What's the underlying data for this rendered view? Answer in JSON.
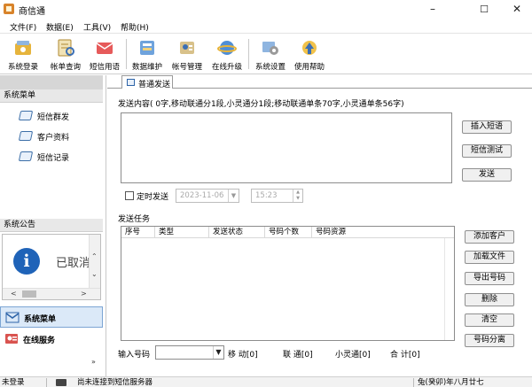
{
  "window": {
    "title": "商信通"
  },
  "menu": [
    "文件(F)",
    "数据(E)",
    "工具(V)",
    "帮助(H)"
  ],
  "toolbar": [
    {
      "label": "系统登录",
      "icon": "login-icon"
    },
    {
      "label": "帐单查询",
      "icon": "bill-query-icon"
    },
    {
      "label": "短信用语",
      "icon": "phrases-icon"
    },
    {
      "label": "数据维护",
      "icon": "data-maintenance-icon"
    },
    {
      "label": "帐号管理",
      "icon": "account-icon"
    },
    {
      "label": "在线升级",
      "icon": "upgrade-icon"
    },
    {
      "label": "系统设置",
      "icon": "settings-icon"
    },
    {
      "label": "使用帮助",
      "icon": "help-icon"
    }
  ],
  "sidebar": {
    "menu_header": "系统菜单",
    "items": [
      "短信群发",
      "客户资料",
      "短信记录"
    ],
    "notice_header": "系统公告",
    "notice_text": "已取消",
    "nav": [
      {
        "label": "系统菜单",
        "icon": "system-menu-icon",
        "active": true
      },
      {
        "label": "在线服务",
        "icon": "online-service-icon",
        "active": false
      }
    ]
  },
  "tab": {
    "label": "普通发送"
  },
  "send": {
    "info": "发送内容( 0字,移动联通分1段,小灵通分1段;移动联通单条70字,小灵通单条56字)",
    "buttons": [
      "插入短语",
      "短信测试",
      "发送"
    ],
    "schedule_label": "定时发送",
    "date": "2023-11-06",
    "time": "15:23"
  },
  "task": {
    "title": "发送任务",
    "columns": [
      "序号",
      "类型",
      "发送状态",
      "号码个数",
      "号码资源"
    ],
    "buttons": [
      "添加客户",
      "加载文件",
      "导出号码",
      "删除",
      "清空",
      "号码分离"
    ]
  },
  "bottom": {
    "input_label": "输入号码",
    "mobile": "移 动[0]",
    "unicom": "联 通[0]",
    "phs": "小灵通[0]",
    "total": "合 计[0]"
  },
  "status": {
    "login": "未登录",
    "connection": "尚未连接到短信服务器",
    "date": "兔(癸卯)年八月廿七"
  },
  "colors": {
    "accent": "#1f63b8",
    "active_nav": "#dbe9f8"
  }
}
